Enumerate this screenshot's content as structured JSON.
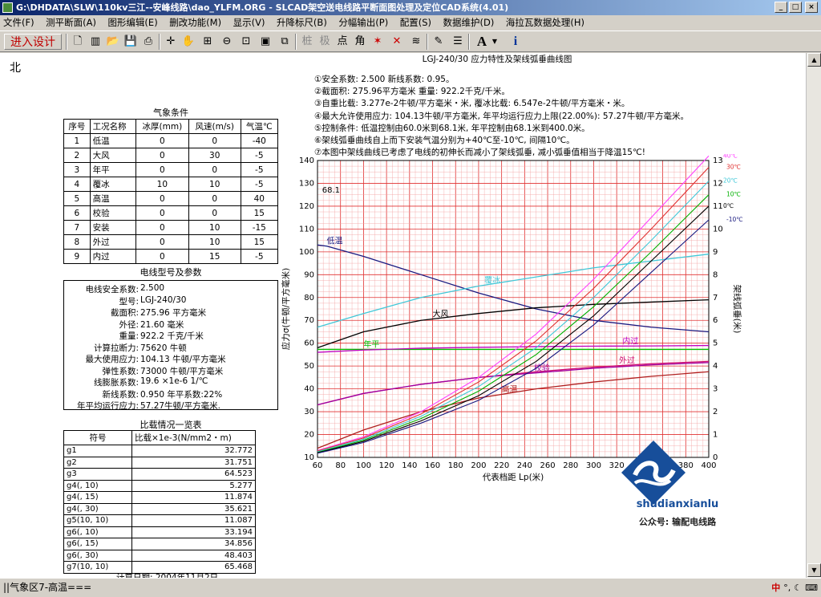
{
  "window": {
    "title": "G:\\DHDATA\\SLW\\110kv三江--安峰线路\\dao_YLFM.ORG - SLCAD架空送电线路平断面图处理及定位CAD系统(4.01)"
  },
  "menu": [
    "文件(F)",
    "测平断面(A)",
    "图形编辑(E)",
    "删改功能(M)",
    "显示(V)",
    "升降标尺(B)",
    "分幅输出(P)",
    "配置(S)",
    "数据维护(D)",
    "海拉瓦数据处理(H)"
  ],
  "toolbar": {
    "enter_design": "进入设计",
    "text_tools": [
      "桩",
      "极",
      "点",
      "角"
    ],
    "font_a": "A",
    "info": "i"
  },
  "north_label": "北",
  "weather": {
    "title": "气象条件",
    "headers": [
      "序号",
      "工况名称",
      "冰厚(mm)",
      "风速(m/s)",
      "气温℃"
    ],
    "rows": [
      [
        "1",
        "低温",
        "0",
        "0",
        "-40"
      ],
      [
        "2",
        "大风",
        "0",
        "30",
        "-5"
      ],
      [
        "3",
        "年平",
        "0",
        "0",
        "-5"
      ],
      [
        "4",
        "覆冰",
        "10",
        "10",
        "-5"
      ],
      [
        "5",
        "高温",
        "0",
        "0",
        "40"
      ],
      [
        "6",
        "校验",
        "0",
        "0",
        "15"
      ],
      [
        "7",
        "安装",
        "0",
        "10",
        "-15"
      ],
      [
        "8",
        "外过",
        "0",
        "10",
        "15"
      ],
      [
        "9",
        "内过",
        "0",
        "15",
        "-5"
      ]
    ]
  },
  "wire": {
    "title": "电线型号及参数",
    "rows": [
      [
        "电线安全系数:",
        "2.500"
      ],
      [
        "型号:",
        "LGJ-240/30"
      ],
      [
        "截面积:",
        "275.96 平方毫米"
      ],
      [
        "外径:",
        "21.60 毫米"
      ],
      [
        "重量:",
        "922.2 千克/千米"
      ],
      [
        "计算拉断力:",
        "75620 牛顿"
      ],
      [
        "最大使用应力:",
        "104.13 牛顿/平方毫米"
      ],
      [
        "弹性系数:",
        "73000 牛顿/平方毫米"
      ],
      [
        "线膨胀系数:",
        "19.6 ×1e-6 1/℃"
      ],
      [
        "新线系数:",
        "0.950   年平系数:22%"
      ],
      [
        "年平均运行应力:",
        "57.27牛顿/平方毫米."
      ]
    ]
  },
  "load": {
    "title": "比载情况一览表",
    "headers": [
      "符号",
      "比载×1e-3(N/mm2・m)"
    ],
    "rows": [
      [
        "g1",
        "32.772"
      ],
      [
        "g2",
        "31.751"
      ],
      [
        "g3",
        "64.523"
      ],
      [
        "g4(, 10)",
        "5.277"
      ],
      [
        "g4(, 15)",
        "11.874"
      ],
      [
        "g4(, 30)",
        "35.621"
      ],
      [
        "g5(10, 10)",
        "11.087"
      ],
      [
        "g6(, 10)",
        "33.194"
      ],
      [
        "g6(, 15)",
        "34.856"
      ],
      [
        "g6(, 30)",
        "48.403"
      ],
      [
        "g7(10, 10)",
        "65.468"
      ]
    ],
    "footer": "计算日期: 2004年11月2日"
  },
  "notes": [
    "①安全系数: 2.500    新线系数: 0.95。",
    "②截面积: 275.96平方毫米    重量:   922.2千克/千米。",
    "③自重比载: 3.277e-2牛顿/平方毫米・米, 覆冰比载: 6.547e-2牛顿/平方毫米・米。",
    "④最大允许使用应力: 104.13牛顿/平方毫米, 年平均运行应力上限(22.00%): 57.27牛顿/平方毫米。",
    "⑤控制条件: 低温控制由60.0米到68.1米, 年平控制由68.1米到400.0米。",
    "⑥架线弧垂曲线自上而下安装气温分别为+40℃至-10℃, 间隔10℃。",
    "⑦本图中架线曲线已考虑了电线的初伸长而减小了架线弧垂, 减小弧垂值相当于降温15℃!"
  ],
  "chart_data": {
    "type": "line",
    "title": "LGJ-240/30 应力特性及架线弧垂曲线图",
    "xlabel": "代表档距 Lp(米)",
    "ylabel": "应力σ(牛顿/平方毫米)",
    "y2label": "架线弧垂(米)",
    "xlim": [
      60,
      400
    ],
    "ylim": [
      10,
      140
    ],
    "y2lim": [
      0,
      13
    ],
    "x_ticks": [
      60,
      80,
      100,
      120,
      140,
      160,
      180,
      200,
      220,
      240,
      260,
      280,
      300,
      320,
      340,
      360,
      380,
      400
    ],
    "y_ticks": [
      10,
      20,
      30,
      40,
      50,
      60,
      70,
      80,
      90,
      100,
      110,
      120,
      130,
      140
    ],
    "y2_ticks": [
      0,
      1,
      2,
      3,
      4,
      5,
      6,
      7,
      8,
      9,
      10,
      11,
      12,
      13
    ],
    "grid": true,
    "annotation": "68.1",
    "stress_series": [
      {
        "name": "低温",
        "color": "#1a1a80",
        "x": [
          60,
          68.1,
          100,
          150,
          200,
          250,
          300,
          350,
          400
        ],
        "y": [
          103,
          102.5,
          98,
          90,
          82,
          75,
          70,
          67,
          65
        ]
      },
      {
        "name": "大风",
        "color": "#000000",
        "x": [
          60,
          100,
          150,
          200,
          250,
          300,
          350,
          400
        ],
        "y": [
          58,
          65,
          70,
          73,
          75.5,
          77,
          78,
          79
        ]
      },
      {
        "name": "覆冰",
        "color": "#40c8d8",
        "x": [
          60,
          100,
          150,
          200,
          250,
          300,
          350,
          400
        ],
        "y": [
          67,
          73,
          80,
          85,
          89,
          93,
          96,
          99
        ]
      },
      {
        "name": "年平",
        "color": "#00c000",
        "x": [
          60,
          400
        ],
        "y": [
          57.27,
          57.27
        ]
      },
      {
        "name": "内过",
        "color": "#c000c0",
        "x": [
          60,
          100,
          150,
          200,
          250,
          300,
          350,
          400
        ],
        "y": [
          56,
          57,
          57.8,
          58.2,
          58.5,
          58.7,
          58.8,
          59
        ]
      },
      {
        "name": "外过",
        "color": "#d01070",
        "x": [
          60,
          100,
          150,
          200,
          250,
          300,
          350,
          400
        ],
        "y": [
          33,
          38,
          42,
          45,
          47.5,
          49.5,
          51,
          52
        ]
      },
      {
        "name": "校验",
        "color": "#a000a0",
        "x": [
          60,
          100,
          150,
          200,
          250,
          300,
          350,
          400
        ],
        "y": [
          33,
          38,
          42,
          45,
          47,
          49,
          50.5,
          51.5
        ]
      },
      {
        "name": "高温",
        "color": "#b02020",
        "x": [
          60,
          100,
          150,
          200,
          250,
          300,
          350,
          400
        ],
        "y": [
          14,
          22,
          30,
          36,
          40,
          43,
          45.5,
          47.5
        ]
      }
    ],
    "sag_series": [
      {
        "name": "40℃",
        "color": "#ff40ff",
        "x": [
          60,
          100,
          150,
          200,
          250,
          300,
          350,
          400
        ],
        "y": [
          0.3,
          0.9,
          2.0,
          3.5,
          5.4,
          7.8,
          10.5,
          13.2
        ]
      },
      {
        "name": "30℃",
        "color": "#e03030",
        "x": [
          60,
          100,
          150,
          200,
          250,
          300,
          350,
          400
        ],
        "y": [
          0.28,
          0.85,
          1.9,
          3.3,
          5.1,
          7.4,
          10.0,
          12.7
        ]
      },
      {
        "name": "20℃",
        "color": "#40c8d8",
        "x": [
          60,
          100,
          150,
          200,
          250,
          300,
          350,
          400
        ],
        "y": [
          0.25,
          0.8,
          1.8,
          3.1,
          4.8,
          7.0,
          9.5,
          12.1
        ]
      },
      {
        "name": "10℃",
        "color": "#00b000",
        "x": [
          60,
          100,
          150,
          200,
          250,
          300,
          350,
          400
        ],
        "y": [
          0.22,
          0.75,
          1.7,
          2.9,
          4.5,
          6.6,
          9.0,
          11.5
        ]
      },
      {
        "name": "0℃",
        "color": "#000000",
        "x": [
          60,
          100,
          150,
          200,
          250,
          300,
          350,
          400
        ],
        "y": [
          0.2,
          0.7,
          1.6,
          2.7,
          4.2,
          6.2,
          8.6,
          11.0
        ]
      },
      {
        "name": "-10℃",
        "color": "#1a1a80",
        "x": [
          60,
          100,
          150,
          200,
          250,
          300,
          350,
          400
        ],
        "y": [
          0.18,
          0.65,
          1.5,
          2.5,
          3.9,
          5.8,
          8.1,
          10.4
        ]
      }
    ]
  },
  "watermark": {
    "brand": "shudianxianlu",
    "sub": "公众号: 输配电线路"
  },
  "status": {
    "text": "||气象区7-高温==="
  }
}
